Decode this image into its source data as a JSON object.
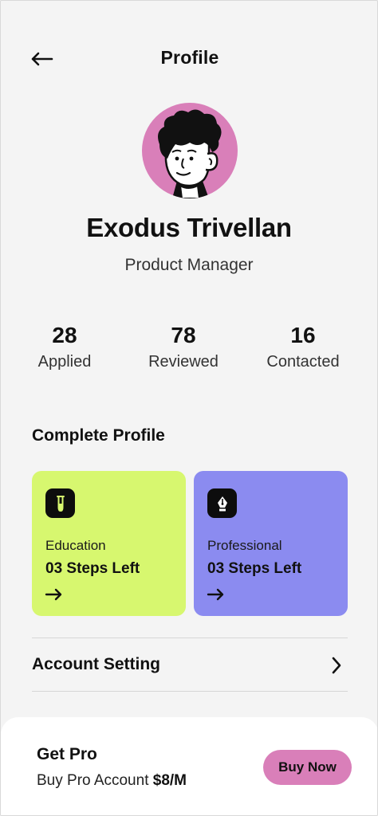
{
  "header": {
    "title": "Profile",
    "back_icon": "arrow-left-icon"
  },
  "profile": {
    "name": "Exodus Trivellan",
    "role": "Product Manager",
    "avatar_bg": "#d97fb9"
  },
  "stats": [
    {
      "value": "28",
      "label": "Applied"
    },
    {
      "value": "78",
      "label": "Reviewed"
    },
    {
      "value": "16",
      "label": "Contacted"
    }
  ],
  "complete_profile": {
    "title": "Complete Profile",
    "cards": [
      {
        "label": "Education",
        "steps": "03 Steps Left",
        "icon": "test-tube-icon",
        "color": "#d7f76f"
      },
      {
        "label": "Professional",
        "steps": "03 Steps Left",
        "icon": "pen-nib-icon",
        "color": "#8b8bf0"
      }
    ]
  },
  "account": {
    "label": "Account Setting",
    "icon": "chevron-right-icon"
  },
  "pro": {
    "title": "Get Pro",
    "subtitle": "Buy Pro Account",
    "price": "$8/M",
    "button_label": "Buy Now",
    "button_color": "#d97fb9"
  }
}
